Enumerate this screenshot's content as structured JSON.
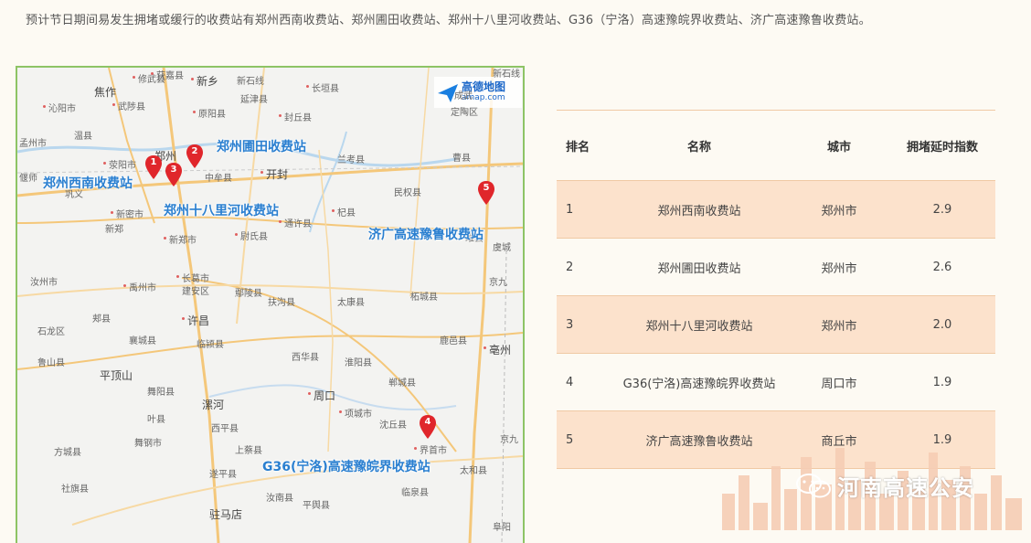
{
  "intro": "预计节日期间易发生拥堵或缓行的收费站有郑州西南收费站、郑州圃田收费站、郑州十八里河收费站、G36（宁洛）高速豫皖界收费站、济广高速豫鲁收费站。",
  "map": {
    "logo_text": "高德地图",
    "logo_sub": "amap.com",
    "callouts": {
      "c1": "郑州西南收费站",
      "c2": "郑州圃田收费站",
      "c3": "郑州十八里河收费站",
      "c4": "G36(宁洛)高速豫皖界收费站",
      "c5": "济广高速豫鲁收费站"
    },
    "pins": [
      "1",
      "2",
      "3",
      "4",
      "5"
    ],
    "places": [
      "修武县",
      "获嘉县",
      "新乡",
      "新石线",
      "长垣县",
      "新石线",
      "焦作",
      "武陟县",
      "原阳县",
      "延津县",
      "封丘县",
      "定陶区",
      "沁阳市",
      "孟州市",
      "温县",
      "荥阳市",
      "郑州",
      "中牟县",
      "开封",
      "兰考县",
      "曹县",
      "巩义",
      "新密市",
      "尉氏县",
      "杞县",
      "民权县",
      "新郑市",
      "新郑",
      "通许县",
      "睢县",
      "长葛市",
      "禹州市",
      "建安区",
      "鄢陵县",
      "扶沟县",
      "太康县",
      "柘城县",
      "汝州市",
      "许昌",
      "郏县",
      "襄城县",
      "临颍县",
      "西华县",
      "淮阳县",
      "鹿邑县",
      "石龙区",
      "鲁山县",
      "平顶山",
      "舞阳县",
      "漯河",
      "周口",
      "郸城县",
      "亳州",
      "叶县",
      "西平县",
      "项城市",
      "沈丘县",
      "方城县",
      "舞钢市",
      "上蔡县",
      "遂平县",
      "太和县",
      "社旗县",
      "驻马店",
      "汝南县",
      "平舆县",
      "临泉县",
      "阜阳",
      "偃师",
      "虞城",
      "成武",
      "京九",
      "京九",
      "界首市"
    ]
  },
  "table": {
    "headers": [
      "排名",
      "名称",
      "城市",
      "拥堵延时指数"
    ],
    "rows": [
      {
        "rank": "1",
        "name": "郑州西南收费站",
        "city": "郑州市",
        "index": "2.9"
      },
      {
        "rank": "2",
        "name": "郑州圃田收费站",
        "city": "郑州市",
        "index": "2.6"
      },
      {
        "rank": "3",
        "name": "郑州十八里河收费站",
        "city": "郑州市",
        "index": "2.0"
      },
      {
        "rank": "4",
        "name": "G36(宁洛)高速豫皖界收费站",
        "city": "周口市",
        "index": "1.9"
      },
      {
        "rank": "5",
        "name": "济广高速豫鲁收费站",
        "city": "商丘市",
        "index": "1.9"
      }
    ]
  },
  "watermark": "河南高速公安",
  "colors": {
    "pin_red": "#e0262b",
    "callout_blue": "#2a7fd0",
    "row_highlight": "#fce2cc",
    "map_border": "#8ec465"
  }
}
